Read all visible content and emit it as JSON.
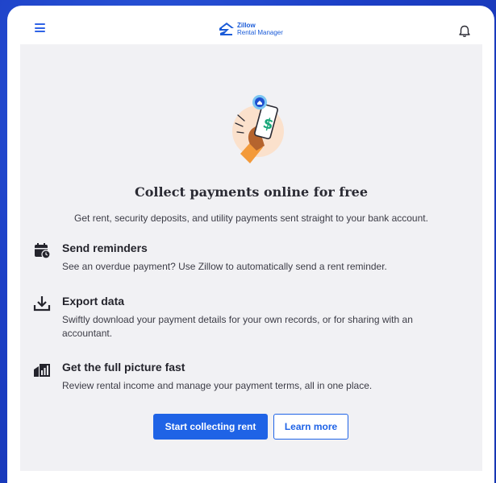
{
  "header": {
    "logo_brand": "Zillow",
    "logo_sub": "Rental Manager",
    "menu_icon": "hamburger-menu-icon",
    "notification_icon": "bell-icon"
  },
  "main": {
    "title": "Collect payments online for free",
    "subtitle": "Get rent, security deposits, and utility payments sent straight to your bank account.",
    "features": [
      {
        "icon": "calendar-clock-icon",
        "heading": "Send reminders",
        "body": "See an overdue payment? Use Zillow to automatically send a rent reminder."
      },
      {
        "icon": "download-icon",
        "heading": "Export data",
        "body": "Swiftly download your payment details for your own records, or for sharing with an accountant."
      },
      {
        "icon": "bar-chart-building-icon",
        "heading": "Get the full picture fast",
        "body": "Review rental income and manage your payment terms, all in one place."
      }
    ],
    "primary_button": "Start collecting rent",
    "secondary_button": "Learn more"
  },
  "colors": {
    "accent": "#1f63e6",
    "background": "#1c3fc6",
    "panel": "#f1f1f4"
  }
}
